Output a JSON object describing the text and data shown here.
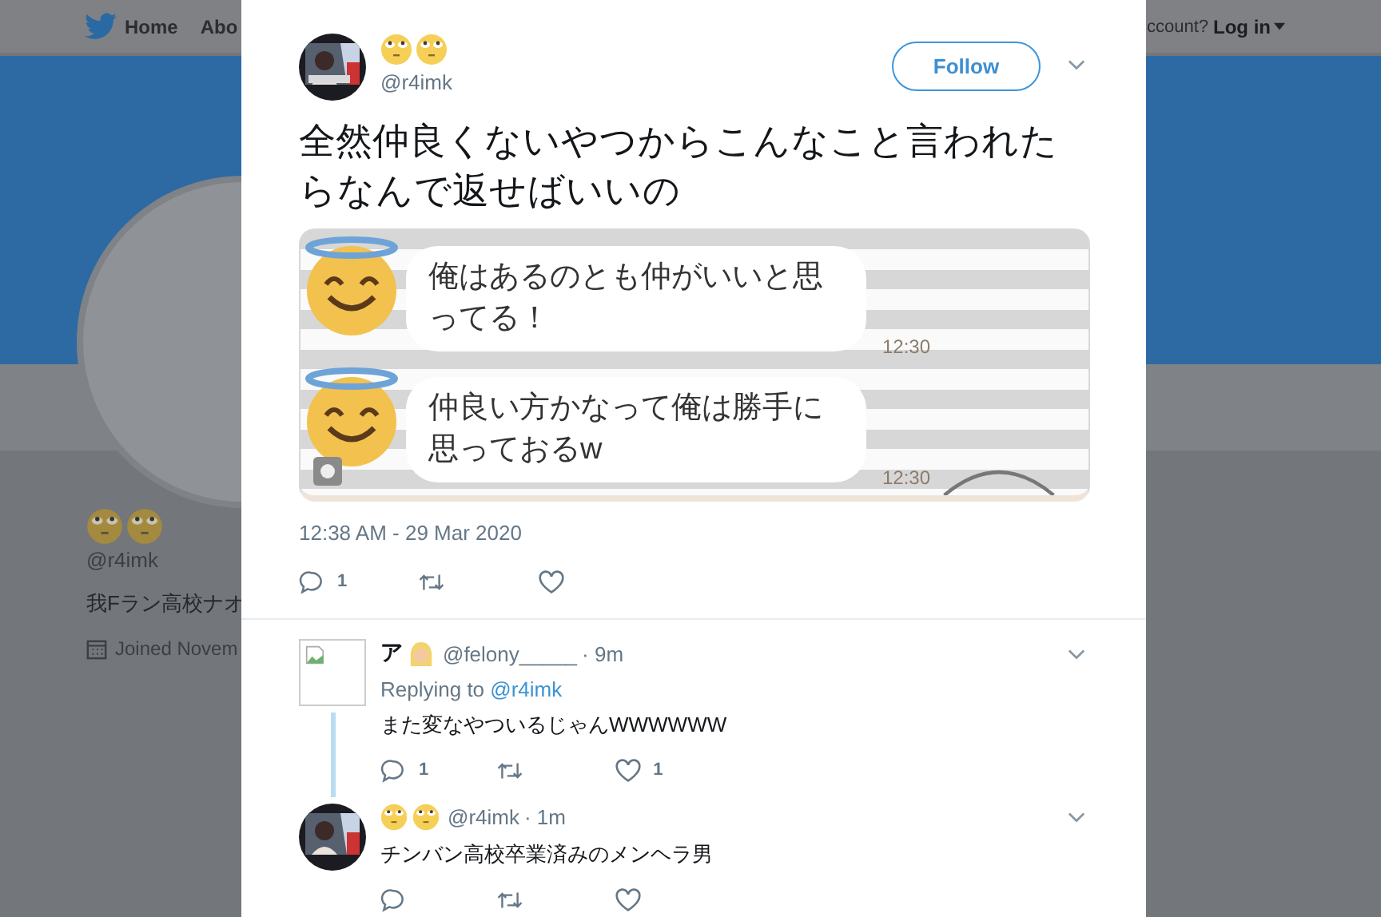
{
  "background_page": {
    "nav": {
      "items": [
        {
          "label": "Home"
        },
        {
          "label": "Abo"
        }
      ],
      "account_prompt": "ccount?",
      "login": "Log in"
    },
    "profile": {
      "handle": "@r4imk",
      "bio": "我Fラン高校ナオ",
      "joined": "Joined Novem"
    }
  },
  "tweet": {
    "handle": "@r4imk",
    "follow_label": "Follow",
    "text": "全然仲良くないやつからこんなこと言われたらなんで返せばいいの",
    "image": {
      "messages": [
        {
          "text": "俺はあるのとも仲がいいと思ってる！",
          "time": "12:30"
        },
        {
          "text": "仲良い方かなって俺は勝手に思っておるw",
          "time": "12:30"
        }
      ]
    },
    "timestamp": "12:38 AM - 29 Mar 2020",
    "actions": [
      {
        "kind": "reply",
        "count": "1"
      },
      {
        "kind": "retweet"
      },
      {
        "kind": "like"
      }
    ]
  },
  "replies": [
    {
      "name": "ア",
      "handle": "@felony_____",
      "time": "· 9m",
      "replying_prefix": "Replying to",
      "replying_handle": "@r4imk",
      "text": "また変なやついるじゃんWWWWWW",
      "thread_line": true,
      "actions": [
        {
          "kind": "reply",
          "count": "1"
        },
        {
          "kind": "retweet"
        },
        {
          "kind": "like",
          "count": "1"
        }
      ]
    },
    {
      "handle": "@r4imk",
      "time": "· 1m",
      "text": "チンバン高校卒業済みのメンヘラ男",
      "thread_line": false,
      "actions": [
        {
          "kind": "reply"
        },
        {
          "kind": "retweet"
        },
        {
          "kind": "like"
        }
      ]
    }
  ]
}
